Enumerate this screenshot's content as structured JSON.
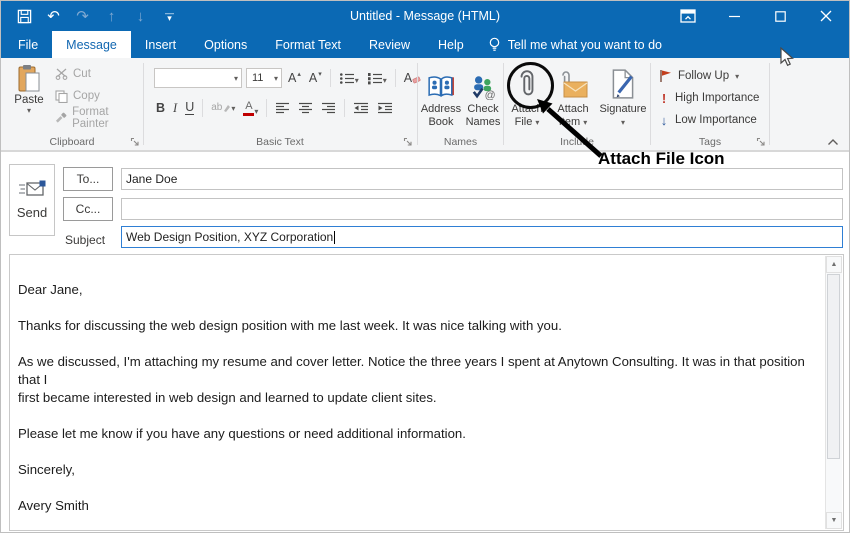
{
  "window": {
    "title": "Untitled - Message (HTML)"
  },
  "tabs": {
    "file": "File",
    "message": "Message",
    "insert": "Insert",
    "options": "Options",
    "format_text": "Format Text",
    "review": "Review",
    "help": "Help",
    "tell_me": "Tell me what you want to do"
  },
  "ribbon": {
    "clipboard": {
      "label": "Clipboard",
      "paste": "Paste",
      "cut": "Cut",
      "copy": "Copy",
      "format_painter": "Format Painter"
    },
    "basic_text": {
      "label": "Basic Text",
      "font_name": "",
      "font_size": "11",
      "bold": "B",
      "italic": "I",
      "underline": "U"
    },
    "names": {
      "label": "Names",
      "address_book_1": "Address",
      "address_book_2": "Book",
      "check_names_1": "Check",
      "check_names_2": "Names"
    },
    "include": {
      "label": "Include",
      "attach_file_1": "Attach",
      "attach_file_2": "File",
      "attach_item_1": "Attach",
      "attach_item_2": "Item",
      "signature": "Signature"
    },
    "tags": {
      "label": "Tags",
      "follow_up": "Follow Up",
      "high_importance": "High Importance",
      "low_importance": "Low Importance"
    }
  },
  "annotation": {
    "label": "Attach File Icon"
  },
  "compose": {
    "send_label": "Send",
    "to_button": "To...",
    "cc_button": "Cc...",
    "subject_label": "Subject",
    "to_value": "Jane Doe",
    "cc_value": "",
    "subject_value": "Web Design Position, XYZ Corporation"
  },
  "body": {
    "greeting": "Dear Jane,",
    "p1": "Thanks for discussing the web design position with me last week. It was nice talking with you.",
    "p2": "As we discussed, I'm attaching my resume and cover letter. Notice the three years I spent at Anytown Consulting. It was in that position that I\nfirst became interested in web design and learned to update client sites.",
    "p3": "Please let me know if you have any questions or need additional information.",
    "closing": "Sincerely,",
    "signature": "Avery Smith"
  },
  "glyphs": {
    "caret": "▾",
    "undo": "↶",
    "redo": "↷",
    "up_arrow": "↑",
    "down_arrow": "↓",
    "a": "A",
    "up_small": "▴",
    "down_small": "▾",
    "ab": "ab",
    "exclam": "!",
    "at": "@",
    "tri_up": "▲",
    "tri_down": "▼",
    "chevron_up": "⌃"
  },
  "colors": {
    "titlebar_blue": "#0b69b4",
    "selected_tab_text": "#1267b1",
    "accent_red": "#c0392b",
    "accent_blue": "#2b579a",
    "envelope_tan": "#eab05e",
    "annotation_black": "#000000",
    "subject_focus_border": "#2f7fd4"
  }
}
